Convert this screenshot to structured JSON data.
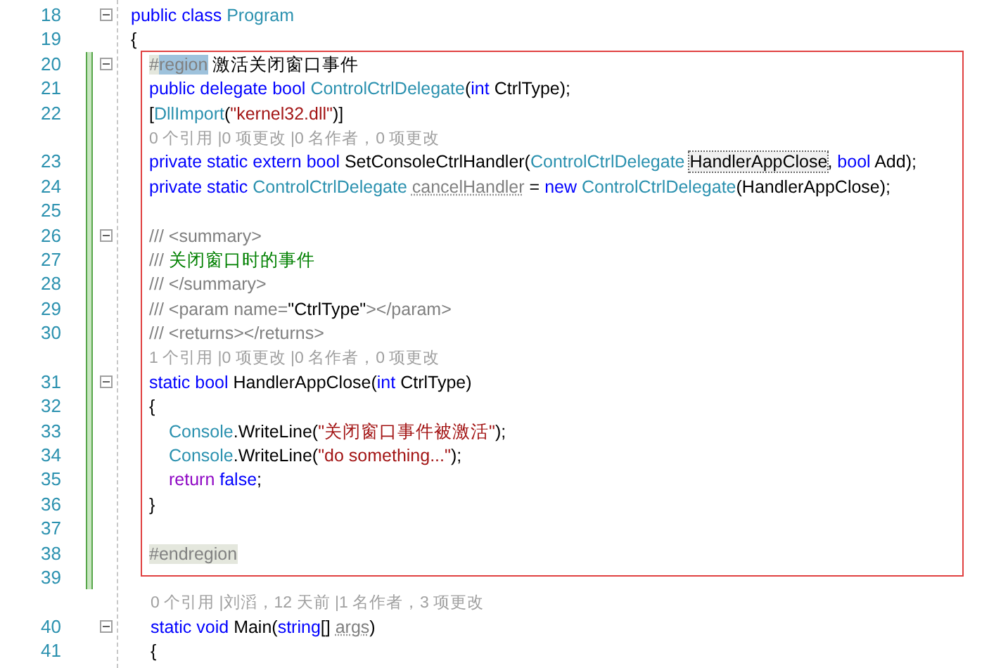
{
  "editor": {
    "lines_before": [
      {
        "kind": "code",
        "number": "18",
        "fold": true,
        "changed": false,
        "tokens": [
          {
            "text": "public class ",
            "kind": "keyword"
          },
          {
            "text": "Program",
            "kind": "type"
          }
        ]
      },
      {
        "kind": "code",
        "number": "19",
        "fold": false,
        "changed": false,
        "tokens": [
          {
            "text": "{",
            "kind": "plain"
          }
        ]
      }
    ],
    "region": {
      "lines": [
        {
          "kind": "code",
          "number": "20",
          "fold": true,
          "changed": true,
          "tokens": [
            {
              "text": "#",
              "kind": "shaded"
            },
            {
              "text": "region",
              "kind": "selected"
            },
            {
              "text": " 激活关闭窗口事件",
              "kind": "plain"
            }
          ]
        },
        {
          "kind": "code",
          "number": "21",
          "fold": false,
          "changed": true,
          "tokens": [
            {
              "text": "public delegate bool ",
              "kind": "keyword"
            },
            {
              "text": "ControlCtrlDelegate",
              "kind": "type"
            },
            {
              "text": "(",
              "kind": "plain"
            },
            {
              "text": "int",
              "kind": "keyword"
            },
            {
              "text": " CtrlType);",
              "kind": "plain"
            }
          ]
        },
        {
          "kind": "code",
          "number": "22",
          "fold": false,
          "changed": true,
          "tokens": [
            {
              "text": "[",
              "kind": "plain"
            },
            {
              "text": "DllImport",
              "kind": "type"
            },
            {
              "text": "(",
              "kind": "plain"
            },
            {
              "text": "\"kernel32.dll\"",
              "kind": "string"
            },
            {
              "text": ")]",
              "kind": "plain"
            }
          ]
        },
        {
          "kind": "lens",
          "changed": true,
          "text": "0 个引用 |0 项更改 |0 名作者，0 项更改"
        },
        {
          "kind": "code",
          "number": "23",
          "fold": false,
          "changed": true,
          "tokens": [
            {
              "text": "private static extern bool ",
              "kind": "keyword"
            },
            {
              "text": "SetConsoleCtrlHandler(",
              "kind": "plain"
            },
            {
              "text": "ControlCtrlDelegate ",
              "kind": "type"
            },
            {
              "text": "HandlerAppClose",
              "kind": "boxed"
            },
            {
              "text": ", ",
              "kind": "plain"
            },
            {
              "text": "bool",
              "kind": "keyword"
            },
            {
              "text": " Add);",
              "kind": "plain"
            }
          ]
        },
        {
          "kind": "code",
          "number": "24",
          "fold": false,
          "changed": true,
          "tokens": [
            {
              "text": "private static ",
              "kind": "keyword"
            },
            {
              "text": "ControlCtrlDelegate ",
              "kind": "type"
            },
            {
              "text": "cancelHandler",
              "kind": "unused"
            },
            {
              "text": " = ",
              "kind": "plain"
            },
            {
              "text": "new ",
              "kind": "keyword"
            },
            {
              "text": "ControlCtrlDelegate",
              "kind": "type"
            },
            {
              "text": "(HandlerAppClose);",
              "kind": "plain"
            }
          ]
        },
        {
          "kind": "code",
          "number": "25",
          "fold": false,
          "changed": true
        },
        {
          "kind": "code",
          "number": "26",
          "fold": true,
          "changed": true,
          "tokens": [
            {
              "text": "/// <summary>",
              "kind": "doc"
            }
          ]
        },
        {
          "kind": "code",
          "number": "27",
          "fold": false,
          "changed": true,
          "tokens": [
            {
              "text": "///",
              "kind": "doc"
            },
            {
              "text": " 关闭窗口时的事件",
              "kind": "comment"
            }
          ]
        },
        {
          "kind": "code",
          "number": "28",
          "fold": false,
          "changed": true,
          "tokens": [
            {
              "text": "/// </summary>",
              "kind": "doc"
            }
          ]
        },
        {
          "kind": "code",
          "number": "29",
          "fold": false,
          "changed": true,
          "tokens": [
            {
              "text": "/// <param name=",
              "kind": "doc"
            },
            {
              "text": "\"CtrlType\"",
              "kind": "plain"
            },
            {
              "text": "></param>",
              "kind": "doc"
            }
          ]
        },
        {
          "kind": "code",
          "number": "30",
          "fold": false,
          "changed": true,
          "tokens": [
            {
              "text": "/// <returns></returns>",
              "kind": "doc"
            }
          ]
        },
        {
          "kind": "lens",
          "changed": true,
          "text": "1 个引用 |0 项更改 |0 名作者，0 项更改"
        },
        {
          "kind": "code",
          "number": "31",
          "fold": true,
          "changed": true,
          "tokens": [
            {
              "text": "static bool ",
              "kind": "keyword"
            },
            {
              "text": "HandlerAppClose(",
              "kind": "plain"
            },
            {
              "text": "int",
              "kind": "keyword"
            },
            {
              "text": " CtrlType)",
              "kind": "plain"
            }
          ]
        },
        {
          "kind": "code",
          "number": "32",
          "fold": false,
          "changed": true,
          "tokens": [
            {
              "text": "{",
              "kind": "plain"
            }
          ],
          "children": [
            {
              "kind": "code",
              "number": "33",
              "fold": false,
              "changed": true,
              "tokens": [
                {
                  "text": "Console",
                  "kind": "type"
                },
                {
                  "text": ".WriteLine(",
                  "kind": "plain"
                },
                {
                  "text": "\"关闭窗口事件被激活\"",
                  "kind": "string"
                },
                {
                  "text": ");",
                  "kind": "plain"
                }
              ]
            },
            {
              "kind": "code",
              "number": "34",
              "fold": false,
              "changed": true,
              "tokens": [
                {
                  "text": "Console",
                  "kind": "type"
                },
                {
                  "text": ".WriteLine(",
                  "kind": "plain"
                },
                {
                  "text": "\"do something...\"",
                  "kind": "string"
                },
                {
                  "text": ");",
                  "kind": "plain"
                }
              ]
            },
            {
              "kind": "code",
              "number": "35",
              "fold": false,
              "changed": true,
              "tokens": [
                {
                  "text": "return",
                  "kind": "control"
                },
                {
                  "text": " false",
                  "kind": "keyword"
                },
                {
                  "text": ";",
                  "kind": "plain"
                }
              ]
            }
          ]
        },
        {
          "kind": "code",
          "number": "36",
          "fold": false,
          "changed": true,
          "tokens": [
            {
              "text": "}",
              "kind": "plain"
            }
          ]
        },
        {
          "kind": "code",
          "number": "37",
          "fold": false,
          "changed": true
        },
        {
          "kind": "code",
          "number": "38",
          "fold": false,
          "changed": true,
          "tokens": [
            {
              "text": "#endregion",
              "kind": "shaded"
            }
          ]
        }
      ]
    },
    "lines_after": [
      {
        "kind": "code",
        "number": "39",
        "fold": false,
        "changed": true
      },
      {
        "kind": "lens",
        "changed": false,
        "text": "0 个引用 |刘滔，12 天前 |1 名作者，3 项更改"
      },
      {
        "kind": "code",
        "number": "40",
        "fold": true,
        "changed": false,
        "tokens": [
          {
            "text": "static void ",
            "kind": "keyword"
          },
          {
            "text": "Main(",
            "kind": "plain"
          },
          {
            "text": "string",
            "kind": "keyword"
          },
          {
            "text": "[] ",
            "kind": "plain"
          },
          {
            "text": "args",
            "kind": "unused"
          },
          {
            "text": ")",
            "kind": "plain"
          }
        ]
      },
      {
        "kind": "code",
        "number": "41",
        "fold": false,
        "changed": false,
        "tokens": [
          {
            "text": "{",
            "kind": "plain"
          }
        ]
      }
    ]
  }
}
